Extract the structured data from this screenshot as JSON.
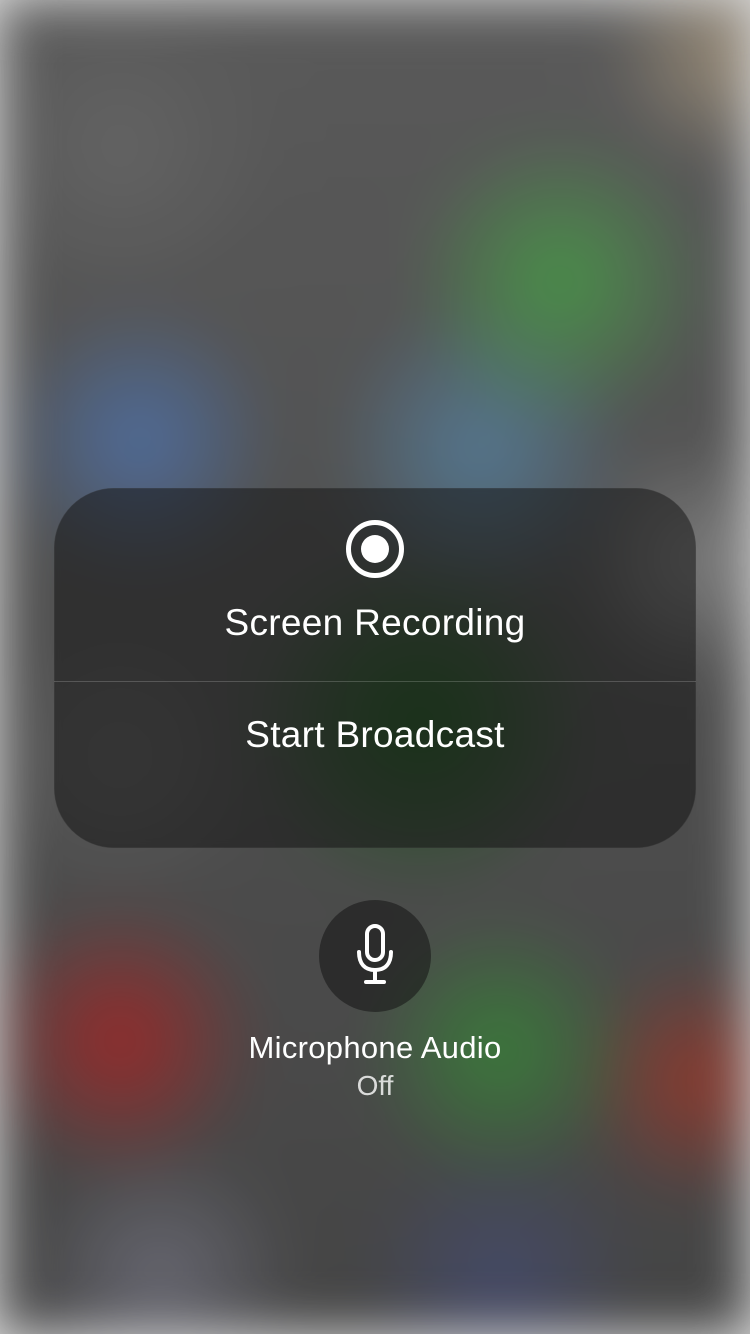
{
  "card": {
    "title": "Screen Recording",
    "action_label": "Start Broadcast"
  },
  "microphone": {
    "label": "Microphone Audio",
    "state": "Off"
  }
}
